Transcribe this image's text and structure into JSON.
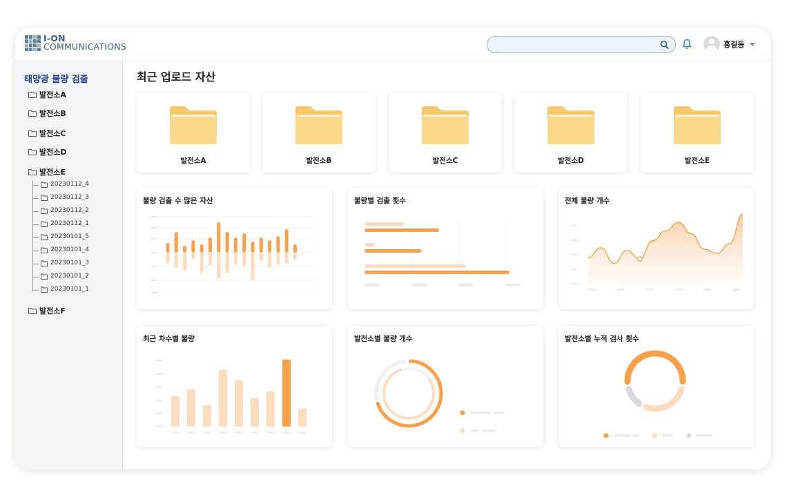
{
  "brand": {
    "line1": "I-ON",
    "line2": "COMMUNICATIONS",
    "accent": "#3a5f8a"
  },
  "search": {
    "placeholder": "",
    "value": ""
  },
  "user": {
    "name": "홍길동"
  },
  "sidebar": {
    "title": "태양광 불량 검출",
    "items": [
      {
        "label": "발전소A"
      },
      {
        "label": "발전소B"
      },
      {
        "label": "발전소C"
      },
      {
        "label": "발전소D"
      },
      {
        "label": "발전소E"
      },
      {
        "label": "발전소F"
      }
    ],
    "sub_items": [
      {
        "label": "20230112_4"
      },
      {
        "label": "20230112_3"
      },
      {
        "label": "20230112_2"
      },
      {
        "label": "20230112_1"
      },
      {
        "label": "20230101_5"
      },
      {
        "label": "20230101_4"
      },
      {
        "label": "20230101_3"
      },
      {
        "label": "20230101_2"
      },
      {
        "label": "20230101_1"
      }
    ]
  },
  "main": {
    "title": "최근 업로드 자산",
    "folders": [
      {
        "label": "발전소A"
      },
      {
        "label": "발전소B"
      },
      {
        "label": "발전소C"
      },
      {
        "label": "발전소D"
      },
      {
        "label": "발전소E"
      }
    ]
  },
  "colors": {
    "orange": "#f7a24b",
    "peach": "#fcdcbf",
    "folder": "#fcd98a",
    "folder_dark": "#f7c96b",
    "grey": "#dcdcdc"
  },
  "chart_data": [
    {
      "type": "bar",
      "title": "불량 검출 수 많은 자산",
      "series": [
        {
          "values": [
            14,
            30,
            10,
            18,
            12,
            22,
            44,
            30,
            22,
            28,
            16,
            22,
            18,
            24,
            34,
            12
          ]
        },
        {
          "values": [
            -16,
            -22,
            -26,
            -10,
            -30,
            -18,
            -38,
            -30,
            -18,
            -20,
            -40,
            -12,
            -22,
            -18,
            -16,
            -10
          ]
        }
      ]
    },
    {
      "type": "bar",
      "title": "불량별 검출 횟수",
      "series": [
        {
          "values": [
            27,
            7,
            69
          ]
        },
        {
          "values": [
            51,
            39,
            99
          ]
        }
      ]
    },
    {
      "type": "area",
      "title": "전체 불량 개수",
      "values": [
        38,
        52,
        30,
        48,
        36,
        62,
        76,
        88,
        72,
        50,
        44,
        58,
        100
      ]
    },
    {
      "type": "bar",
      "title": "최근 차수별 불량",
      "values": [
        44,
        54,
        31,
        82,
        67,
        41,
        51,
        97,
        26
      ]
    },
    {
      "type": "pie",
      "title": "발전소별 불량 개수",
      "values": [
        70,
        30
      ]
    },
    {
      "type": "pie",
      "title": "발전소별 누적 검사 횟수",
      "values": [
        55,
        30,
        15
      ]
    }
  ]
}
